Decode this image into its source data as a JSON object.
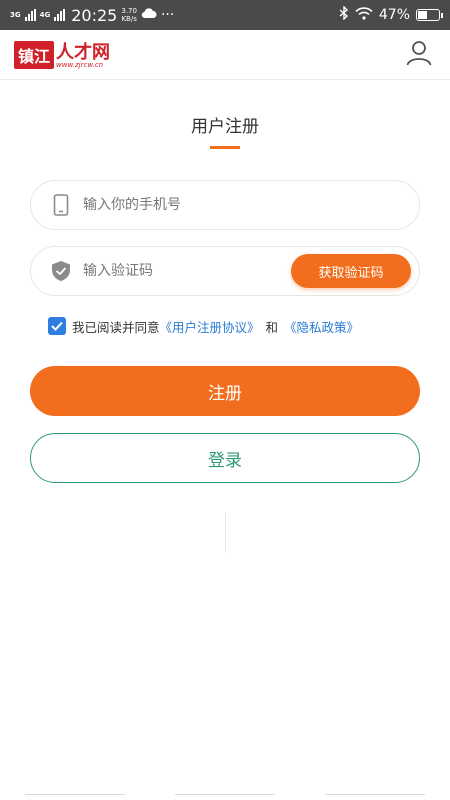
{
  "status_bar": {
    "network_1": "3G",
    "network_2": "4G",
    "time": "20:25",
    "speed_value": "3.70",
    "speed_unit": "KB/s",
    "overflow": "···",
    "battery_percent": "47%",
    "battery_level": 0.47
  },
  "header": {
    "logo_seal": "镇江",
    "logo_name": "人才网",
    "logo_url": "www.zjrcw.cn",
    "user_icon": "user-icon"
  },
  "page": {
    "title": "用户注册",
    "accent_color": "#f26e1e",
    "login_color": "#2f9a72"
  },
  "form": {
    "phone_placeholder": "输入你的手机号",
    "phone_value": "",
    "code_placeholder": "输入验证码",
    "code_value": "",
    "get_code_label": "获取验证码",
    "agreement_prefix": "我已阅读并同意",
    "agreement_link_1": "《用户注册协议》",
    "agreement_and": "和",
    "agreement_link_2": "《隐私政策》",
    "agreement_checked": true
  },
  "actions": {
    "register_label": "注册",
    "login_label": "登录"
  }
}
